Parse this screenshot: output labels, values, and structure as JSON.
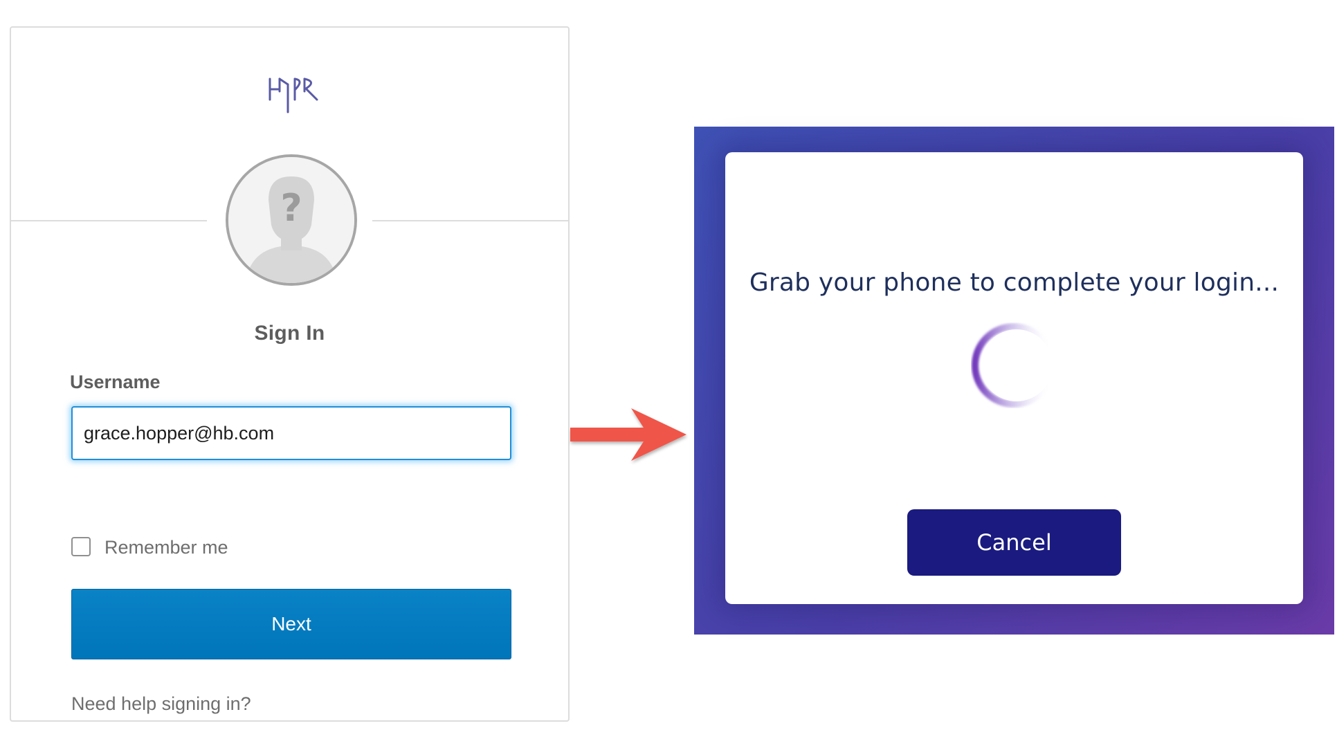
{
  "signin": {
    "logo_text": "HYPR",
    "title": "Sign In",
    "username_label": "Username",
    "username_value": "grace.hopper@hb.com",
    "remember_label": "Remember me",
    "remember_checked": false,
    "next_label": "Next",
    "help_link": "Need help signing in?",
    "avatar_icon": "unknown-user-icon",
    "input_focus_color": "#1f8ed6",
    "button_color": "#0075ba"
  },
  "arrow": {
    "icon": "right-arrow-icon",
    "color": "#f0544a"
  },
  "hypr_modal": {
    "message": "Grab your phone to complete your login...",
    "spinner_icon": "loading-spinner-icon",
    "cancel_label": "Cancel",
    "frame_colors": [
      "#3f51b5",
      "#6a3ba8"
    ],
    "button_color": "#1a1a80"
  }
}
